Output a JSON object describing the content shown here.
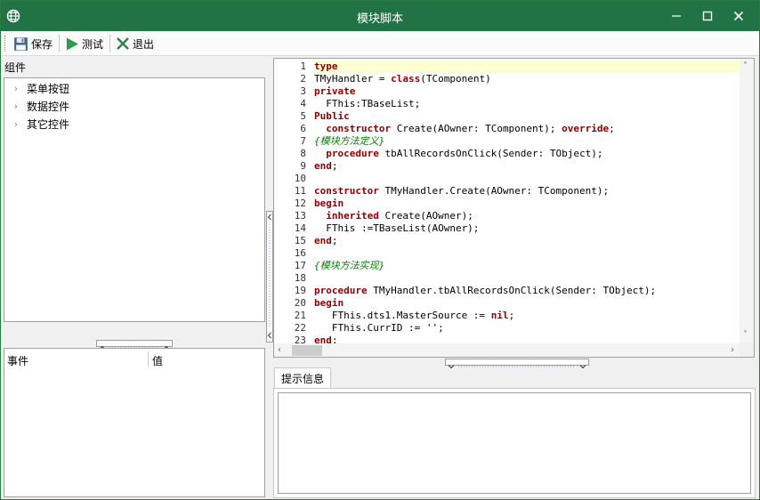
{
  "window": {
    "title": "模块脚本"
  },
  "toolbar": {
    "save_label": "保存",
    "test_label": "测试",
    "exit_label": "退出"
  },
  "left": {
    "label": "组件",
    "tree": [
      {
        "label": "菜单按钮"
      },
      {
        "label": "数据控件"
      },
      {
        "label": "其它控件"
      }
    ],
    "events": {
      "col1": "事件",
      "col2": "值"
    }
  },
  "editor": {
    "lines": [
      {
        "n": "1",
        "tokens": [
          {
            "t": "type",
            "c": "kw"
          }
        ]
      },
      {
        "n": "2",
        "tokens": [
          {
            "t": "TMyHandler = "
          },
          {
            "t": "class",
            "c": "kw"
          },
          {
            "t": "(TComponent)"
          }
        ]
      },
      {
        "n": "3",
        "tokens": [
          {
            "t": "private",
            "c": "kw"
          }
        ]
      },
      {
        "n": "4",
        "tokens": [
          {
            "t": "  FThis:TBaseList;"
          }
        ]
      },
      {
        "n": "5",
        "tokens": [
          {
            "t": "Public",
            "c": "kw"
          }
        ]
      },
      {
        "n": "6",
        "tokens": [
          {
            "t": "  "
          },
          {
            "t": "constructor",
            "c": "kw"
          },
          {
            "t": " Create(AOwner: TComponent); "
          },
          {
            "t": "override",
            "c": "kw"
          },
          {
            "t": ";"
          }
        ]
      },
      {
        "n": "7",
        "tokens": [
          {
            "t": "{模块方法定义}",
            "c": "cm"
          }
        ]
      },
      {
        "n": "8",
        "tokens": [
          {
            "t": "  "
          },
          {
            "t": "procedure",
            "c": "kw"
          },
          {
            "t": " tbAllRecordsOnClick(Sender: TObject);"
          }
        ]
      },
      {
        "n": "9",
        "tokens": [
          {
            "t": "end",
            "c": "kw"
          },
          {
            "t": ";"
          }
        ]
      },
      {
        "n": "10",
        "tokens": [
          {
            "t": ""
          }
        ]
      },
      {
        "n": "11",
        "tokens": [
          {
            "t": "constructor",
            "c": "kw"
          },
          {
            "t": " TMyHandler.Create(AOwner: TComponent);"
          }
        ]
      },
      {
        "n": "12",
        "tokens": [
          {
            "t": "begin",
            "c": "kw"
          }
        ]
      },
      {
        "n": "13",
        "tokens": [
          {
            "t": "  "
          },
          {
            "t": "inherited",
            "c": "kw"
          },
          {
            "t": " Create(AOwner);"
          }
        ]
      },
      {
        "n": "14",
        "tokens": [
          {
            "t": "  FThis :=TBaseList(AOwner);"
          }
        ]
      },
      {
        "n": "15",
        "tokens": [
          {
            "t": "end",
            "c": "kw"
          },
          {
            "t": ";"
          }
        ]
      },
      {
        "n": "16",
        "tokens": [
          {
            "t": ""
          }
        ]
      },
      {
        "n": "17",
        "tokens": [
          {
            "t": "{模块方法实现}",
            "c": "cm"
          }
        ]
      },
      {
        "n": "18",
        "tokens": [
          {
            "t": ""
          }
        ]
      },
      {
        "n": "19",
        "tokens": [
          {
            "t": "procedure",
            "c": "kw"
          },
          {
            "t": " TMyHandler.tbAllRecordsOnClick(Sender: TObject);"
          }
        ]
      },
      {
        "n": "20",
        "tokens": [
          {
            "t": "begin",
            "c": "kw"
          }
        ]
      },
      {
        "n": "21",
        "tokens": [
          {
            "t": "   FThis.dts1.MasterSource := "
          },
          {
            "t": "nil",
            "c": "kw"
          },
          {
            "t": ";"
          }
        ]
      },
      {
        "n": "22",
        "tokens": [
          {
            "t": "   FThis.CurrID := '';"
          }
        ]
      },
      {
        "n": "23",
        "tokens": [
          {
            "t": "end",
            "c": "kw"
          },
          {
            "t": ";"
          }
        ]
      }
    ]
  },
  "hint": {
    "tab_label": "提示信息",
    "text": ""
  },
  "colors": {
    "titlebar": "#217346",
    "keyword": "#8b0000",
    "comment": "#008000",
    "active_line": "#ffffd4"
  },
  "icons": {
    "app": "globe-icon",
    "minimize": "minimize-icon",
    "maximize": "maximize-icon",
    "close": "close-icon",
    "save": "save-icon",
    "test": "play-icon",
    "exit": "exit-icon"
  }
}
